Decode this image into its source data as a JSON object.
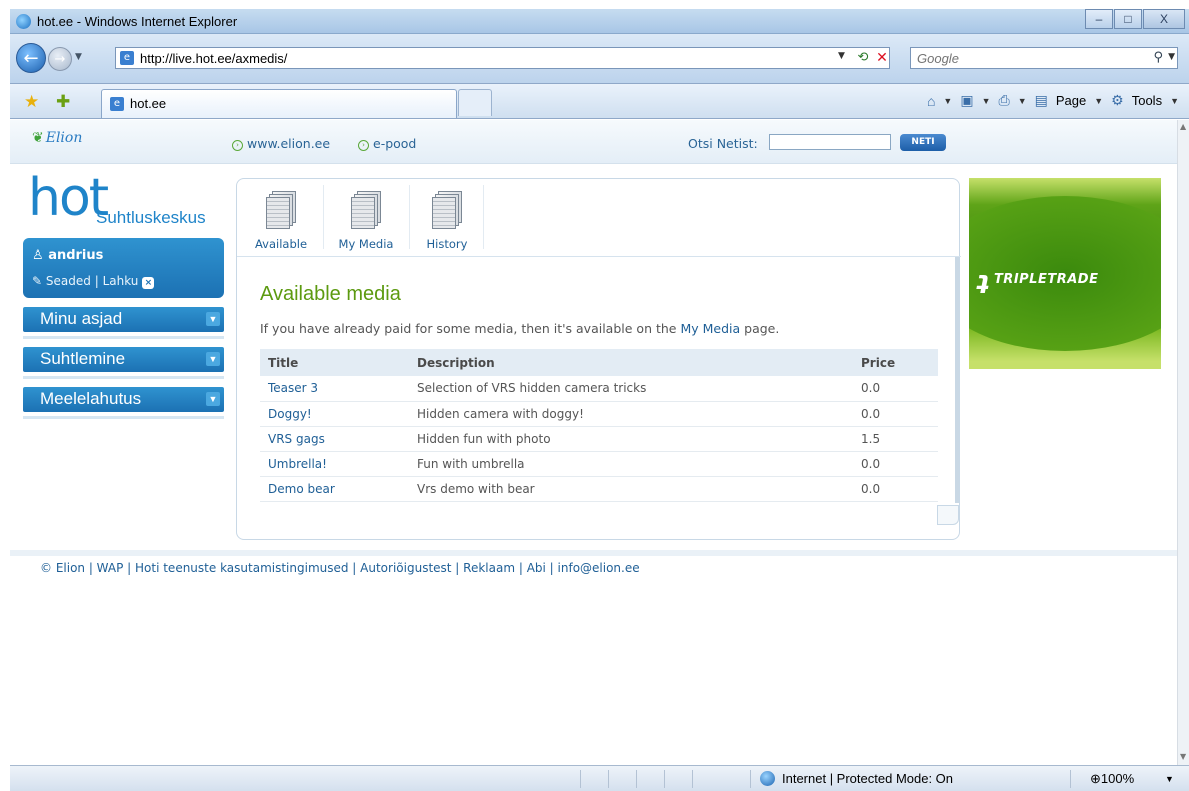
{
  "window": {
    "title": "hot.ee - Windows Internet Explorer",
    "minimize": "–",
    "maximize": "□",
    "close": "X"
  },
  "navbar": {
    "url": "http://live.hot.ee/axmedis/",
    "search_placeholder": "Google"
  },
  "tabs": [
    {
      "label": "hot.ee"
    }
  ],
  "commandbar": {
    "page": "Page",
    "tools": "Tools"
  },
  "site": {
    "logo": "Elion",
    "links": [
      "www.elion.ee",
      "e-pood"
    ],
    "search_label": "Otsi Netist:",
    "search_button": "NETI",
    "hot_logo": "hot",
    "hot_sub": "Suhtluskeskus",
    "user": {
      "name": "andrius",
      "settings": "Seaded",
      "logout": "Lahku"
    },
    "menu": [
      "Minu asjad",
      "Suhtlemine",
      "Meelelahutus"
    ]
  },
  "media_tabs": [
    "Available",
    "My Media",
    "History"
  ],
  "content": {
    "heading": "Available media",
    "intro_before": "If you have already paid for some media, then it's available on the ",
    "intro_link": "My Media",
    "intro_after": " page."
  },
  "table": {
    "headers": [
      "Title",
      "Description",
      "Price"
    ],
    "rows": [
      {
        "title": "Teaser 3",
        "description": "Selection of VRS hidden camera tricks",
        "price": "0.0"
      },
      {
        "title": "Doggy!",
        "description": "Hidden camera with doggy!",
        "price": "0.0"
      },
      {
        "title": "VRS gags",
        "description": "Hidden fun with photo",
        "price": "1.5"
      },
      {
        "title": "Umbrella!",
        "description": "Fun with umbrella",
        "price": "0.0"
      },
      {
        "title": "Demo bear",
        "description": "Vrs demo with bear",
        "price": "0.0"
      }
    ]
  },
  "ad": {
    "brand": "TRIPLETRADE"
  },
  "footer": "© Elion | WAP | Hoti teenuste kasutamistingimused | Autoriõigustest | Reklaam | Abi | info@elion.ee",
  "status": {
    "zone": "Internet | Protected Mode: On",
    "zoom": "100%"
  },
  "colors": {
    "accent_blue": "#1f84c9",
    "heading_green": "#5c9a10",
    "link_blue": "#1f5f96"
  }
}
